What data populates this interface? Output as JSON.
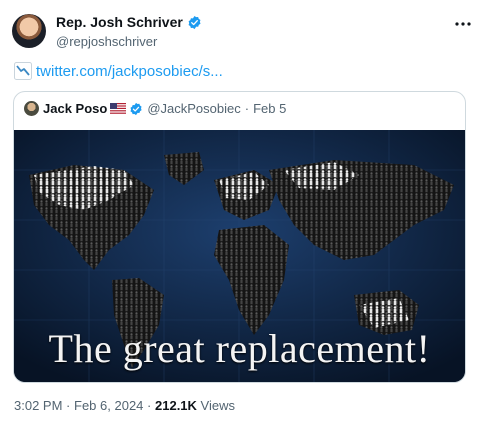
{
  "tweet": {
    "author_name": "Rep. Josh Schriver",
    "author_handle": "@repjoshschriver",
    "link_text": "twitter.com/jackposobiec/s...",
    "time": "3:02 PM",
    "date": "Feb 6, 2024",
    "separator": "·",
    "views_count": "212.1K",
    "views_label": "Views"
  },
  "quoted": {
    "author_name": "Jack Poso",
    "author_handle": "@JackPosobiec",
    "date": "Feb 5",
    "image_caption": "The great replacement!"
  },
  "icons": {
    "verified": "verified-badge-icon",
    "more": "more-options-icon",
    "link_emoji": "chart-decreasing-icon",
    "flag": "us-flag-icon"
  },
  "colors": {
    "link": "#1d9bf0",
    "verified": "#1d9bf0",
    "secondary_text": "#536471",
    "image_bg": "#0b1a31"
  }
}
